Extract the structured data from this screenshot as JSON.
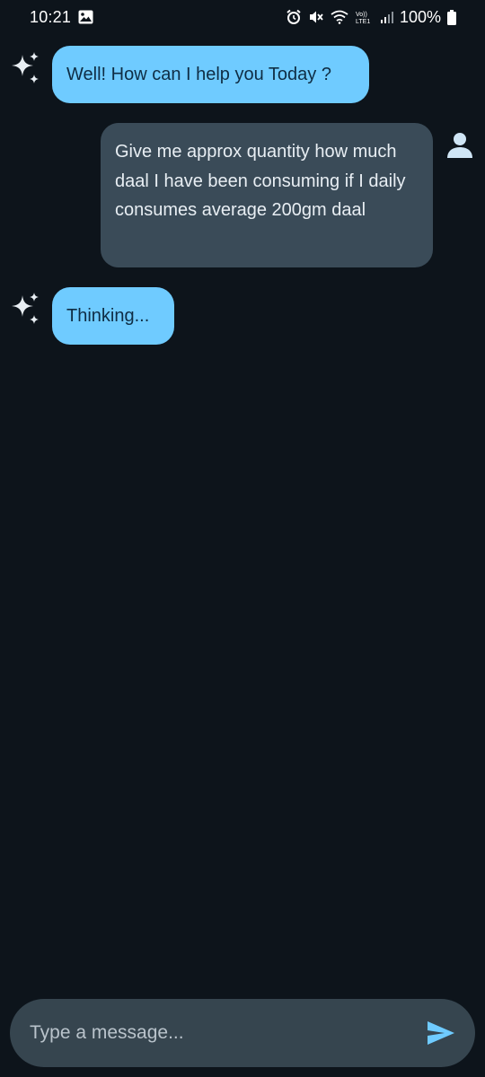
{
  "status_bar": {
    "time": "10:21",
    "battery": "100%",
    "network_label": "Vo)) LTE1"
  },
  "messages": [
    {
      "role": "assistant",
      "text": "Well! How can I help you Today ?"
    },
    {
      "role": "user",
      "text": "Give me approx quantity how much daal I have been consuming if I daily consumes average 200gm daal"
    },
    {
      "role": "assistant",
      "text": "Thinking..."
    }
  ],
  "composer": {
    "placeholder": "Type a message...",
    "value": ""
  },
  "colors": {
    "background": "#0d141b",
    "assistant_bubble": "#6fcbff",
    "user_bubble": "#3a4b58",
    "input_bar": "#36454f",
    "send_icon": "#6fcbff"
  },
  "icons": {
    "assistant_avatar": "sparkles-icon",
    "user_avatar": "person-icon",
    "send": "send-icon"
  }
}
